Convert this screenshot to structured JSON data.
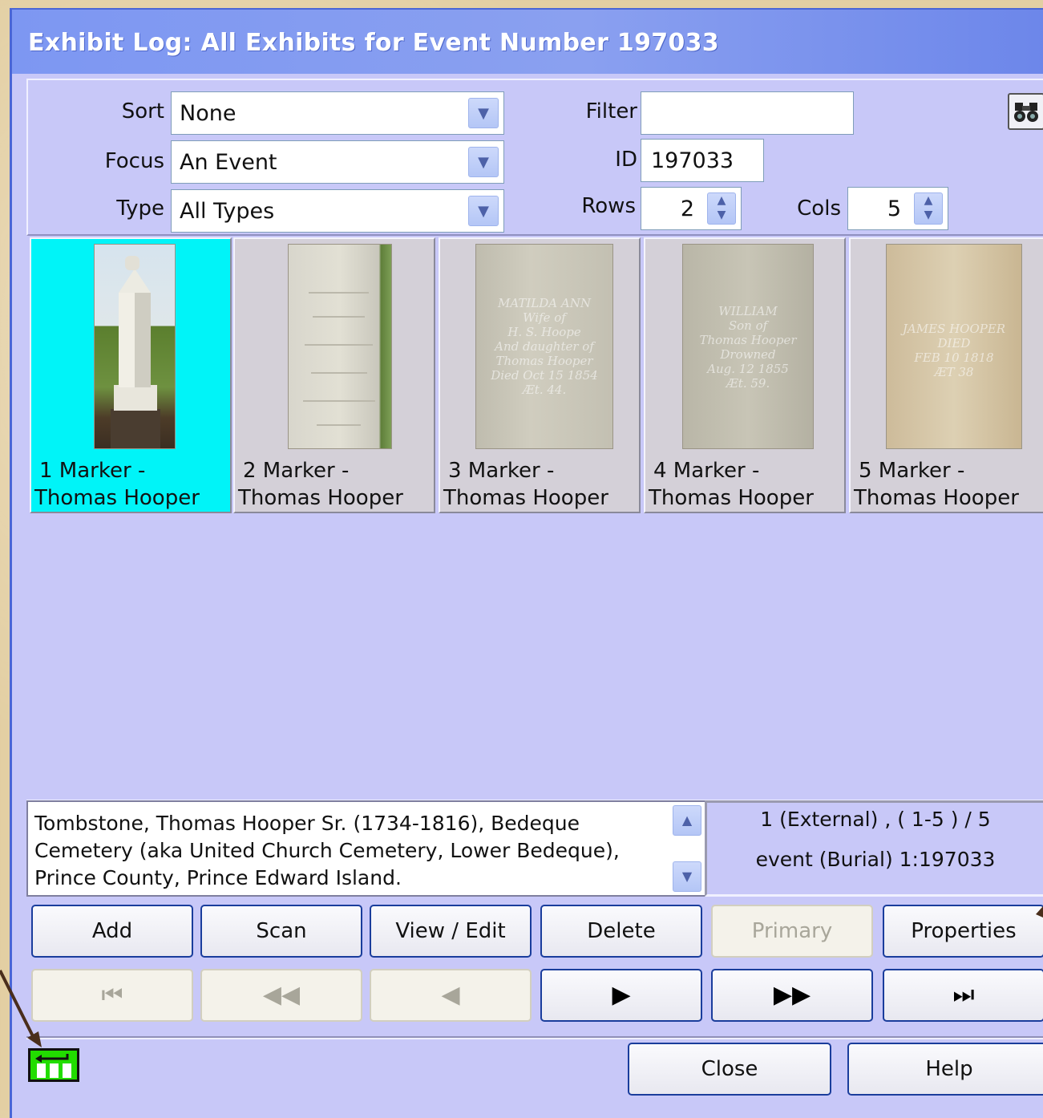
{
  "window": {
    "title": "Exhibit Log: All Exhibits for Event Number 197033"
  },
  "controls": {
    "sort_label": "Sort",
    "sort_value": "None",
    "focus_label": "Focus",
    "focus_value": "An Event",
    "type_label": "Type",
    "type_value": "All Types",
    "filter_label": "Filter",
    "filter_value": "",
    "id_label": "ID",
    "id_value": "197033",
    "rows_label": "Rows",
    "rows_value": "2",
    "cols_label": "Cols",
    "cols_value": "5"
  },
  "gallery": {
    "items": [
      {
        "line1": "1 Marker -",
        "line2": "Thomas Hooper",
        "selected": true
      },
      {
        "line1": "2 Marker -",
        "line2": "Thomas Hooper",
        "selected": false,
        "inscription": ""
      },
      {
        "line1": "3 Marker -",
        "line2": "Thomas Hooper",
        "selected": false,
        "inscription": "MATILDA ANN\nWife of\nH. S. Hoope\nAnd daughter of\nThomas Hooper\nDied Oct 15 1854\nÆt. 44."
      },
      {
        "line1": "4 Marker -",
        "line2": "Thomas Hooper",
        "selected": false,
        "inscription": "WILLIAM\nSon of\nThomas Hooper\nDrowned\nAug. 12 1855\nÆt. 59."
      },
      {
        "line1": "5 Marker -",
        "line2": "Thomas Hooper",
        "selected": false,
        "inscription": "JAMES HOOPER\nDIED\nFEB 10 1818\nÆT 38"
      }
    ]
  },
  "description": {
    "text": "Tombstone, Thomas Hooper Sr. (1734-1816), Bedeque Cemetery (aka United Church Cemetery, Lower Bedeque), Prince County, Prince Edward Island."
  },
  "status": {
    "line1": "1 (External) , ( 1-5 ) / 5",
    "line2": "event (Burial) 1:197033"
  },
  "buttons": {
    "add": "Add",
    "scan": "Scan",
    "view_edit": "View / Edit",
    "delete": "Delete",
    "primary": "Primary",
    "properties": "Properties",
    "close": "Close",
    "help": "Help"
  },
  "nav": {
    "first": "⏮",
    "prev_page": "◀◀",
    "prev": "◀",
    "next": "▶",
    "next_page": "▶▶",
    "last": "⏭"
  },
  "icons": {
    "find": "binoculars-icon",
    "app": "table-switch-icon"
  },
  "colors": {
    "window_bg": "#c8c8f8",
    "title_bar": "#7d97f2",
    "selection": "#00f4f8",
    "button_border": "#1a3d9c",
    "status_icon": "#22dd00"
  }
}
